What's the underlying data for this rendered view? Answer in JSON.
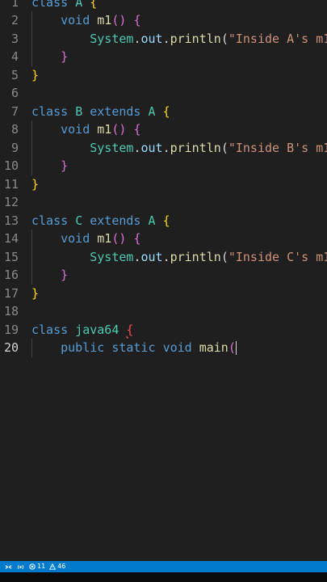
{
  "colors": {
    "background": "#1f1f1f",
    "line_number": "#8a8a8a",
    "keyword": "#569cd6",
    "class_name": "#4ec9b0",
    "function": "#dcdcaa",
    "variable": "#9cdcfe",
    "string": "#ce9178",
    "bracket_level1": "#ffd700",
    "bracket_level2": "#da70d6",
    "error": "#f14c4c",
    "statusbar": "#007acc"
  },
  "editor": {
    "active_line": 20,
    "lines": [
      {
        "n": "1",
        "tokens": [
          [
            "kw",
            "class"
          ],
          [
            "plain",
            " "
          ],
          [
            "type",
            "A"
          ],
          [
            "plain",
            " "
          ],
          [
            "b1",
            "{"
          ]
        ]
      },
      {
        "n": "2",
        "tokens": [
          [
            "plain",
            "    "
          ],
          [
            "kw",
            "void"
          ],
          [
            "plain",
            " "
          ],
          [
            "fn",
            "m1"
          ],
          [
            "b2",
            "()"
          ],
          [
            "plain",
            " "
          ],
          [
            "b2",
            "{"
          ]
        ]
      },
      {
        "n": "3",
        "tokens": [
          [
            "plain",
            "        "
          ],
          [
            "type",
            "System"
          ],
          [
            "plain",
            "."
          ],
          [
            "var",
            "out"
          ],
          [
            "plain",
            "."
          ],
          [
            "fn",
            "println"
          ],
          [
            "plain",
            "("
          ],
          [
            "str",
            "\"Inside A's m1"
          ]
        ]
      },
      {
        "n": "4",
        "tokens": [
          [
            "plain",
            "    "
          ],
          [
            "b2",
            "}"
          ]
        ]
      },
      {
        "n": "5",
        "tokens": [
          [
            "b1",
            "}"
          ]
        ]
      },
      {
        "n": "6",
        "tokens": []
      },
      {
        "n": "7",
        "tokens": [
          [
            "kw",
            "class"
          ],
          [
            "plain",
            " "
          ],
          [
            "type",
            "B"
          ],
          [
            "plain",
            " "
          ],
          [
            "kw",
            "extends"
          ],
          [
            "plain",
            " "
          ],
          [
            "type",
            "A"
          ],
          [
            "plain",
            " "
          ],
          [
            "b1",
            "{"
          ]
        ]
      },
      {
        "n": "8",
        "tokens": [
          [
            "plain",
            "    "
          ],
          [
            "kw",
            "void"
          ],
          [
            "plain",
            " "
          ],
          [
            "fn",
            "m1"
          ],
          [
            "b2",
            "()"
          ],
          [
            "plain",
            " "
          ],
          [
            "b2",
            "{"
          ]
        ]
      },
      {
        "n": "9",
        "tokens": [
          [
            "plain",
            "        "
          ],
          [
            "type",
            "System"
          ],
          [
            "plain",
            "."
          ],
          [
            "var",
            "out"
          ],
          [
            "plain",
            "."
          ],
          [
            "fn",
            "println"
          ],
          [
            "plain",
            "("
          ],
          [
            "str",
            "\"Inside B's m1"
          ]
        ]
      },
      {
        "n": "10",
        "tokens": [
          [
            "plain",
            "    "
          ],
          [
            "b2",
            "}"
          ]
        ]
      },
      {
        "n": "11",
        "tokens": [
          [
            "b1",
            "}"
          ]
        ]
      },
      {
        "n": "12",
        "tokens": []
      },
      {
        "n": "13",
        "tokens": [
          [
            "kw",
            "class"
          ],
          [
            "plain",
            " "
          ],
          [
            "type",
            "C"
          ],
          [
            "plain",
            " "
          ],
          [
            "kw",
            "extends"
          ],
          [
            "plain",
            " "
          ],
          [
            "type",
            "A"
          ],
          [
            "plain",
            " "
          ],
          [
            "b1",
            "{"
          ]
        ]
      },
      {
        "n": "14",
        "tokens": [
          [
            "plain",
            "    "
          ],
          [
            "kw",
            "void"
          ],
          [
            "plain",
            " "
          ],
          [
            "fn",
            "m1"
          ],
          [
            "b2",
            "()"
          ],
          [
            "plain",
            " "
          ],
          [
            "b2",
            "{"
          ]
        ]
      },
      {
        "n": "15",
        "tokens": [
          [
            "plain",
            "        "
          ],
          [
            "type",
            "System"
          ],
          [
            "plain",
            "."
          ],
          [
            "var",
            "out"
          ],
          [
            "plain",
            "."
          ],
          [
            "fn",
            "println"
          ],
          [
            "plain",
            "("
          ],
          [
            "str",
            "\"Inside C's m1"
          ]
        ]
      },
      {
        "n": "16",
        "tokens": [
          [
            "plain",
            "    "
          ],
          [
            "b2",
            "}"
          ]
        ]
      },
      {
        "n": "17",
        "tokens": [
          [
            "b1",
            "}"
          ]
        ]
      },
      {
        "n": "18",
        "tokens": []
      },
      {
        "n": "19",
        "tokens": [
          [
            "kw",
            "class"
          ],
          [
            "plain",
            " "
          ],
          [
            "type",
            "java64"
          ],
          [
            "plain",
            " "
          ],
          [
            "err",
            "{"
          ]
        ]
      },
      {
        "n": "20",
        "tokens": [
          [
            "plain",
            "    "
          ],
          [
            "kw",
            "public"
          ],
          [
            "plain",
            " "
          ],
          [
            "kw",
            "static"
          ],
          [
            "plain",
            " "
          ],
          [
            "kw",
            "void"
          ],
          [
            "plain",
            " "
          ],
          [
            "fn",
            "main"
          ],
          [
            "b2",
            "("
          ]
        ]
      }
    ]
  },
  "statusbar": {
    "remote_icon": "remote-icon",
    "sync_icon": "broadcast-icon",
    "error_icon": "error-circle-icon",
    "errors": "11",
    "warning_icon": "warning-icon",
    "warnings": "46"
  }
}
